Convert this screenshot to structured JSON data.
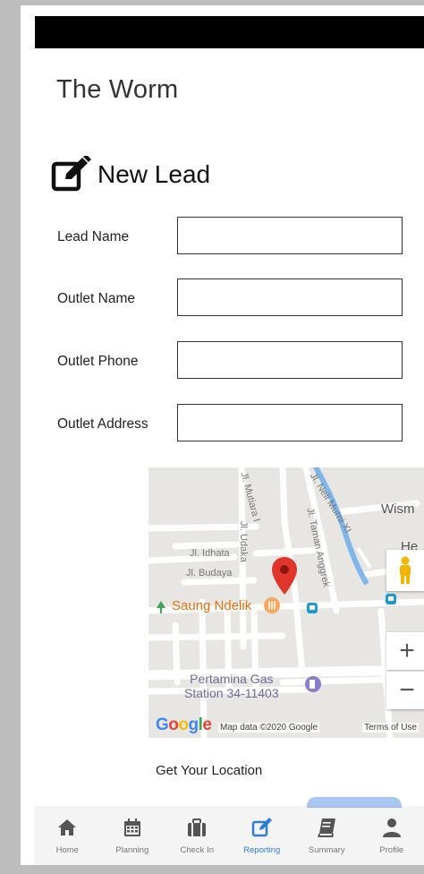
{
  "app": {
    "title": "The Worm"
  },
  "section": {
    "title": "New Lead",
    "icon": "edit-icon"
  },
  "form": {
    "fields": [
      {
        "label": "Lead Name",
        "value": "",
        "placeholder": ""
      },
      {
        "label": "Outlet Name",
        "value": "",
        "placeholder": ""
      },
      {
        "label": "Outlet Phone",
        "value": "",
        "placeholder": ""
      },
      {
        "label": "Outlet Address",
        "value": "",
        "placeholder": ""
      }
    ]
  },
  "map": {
    "labels": {
      "road_udaka": "Jl. Udaka",
      "road_taman_anggrek": "Jl. Taman Anggrek",
      "road_idhata": "Jl. Idhata",
      "road_budaya": "Jl. Budaya",
      "road_neli_murni": "Jl. Neli Murni XI",
      "area_wism": "Wism",
      "area_he": "He",
      "road_top": "Jl. Mutiara I",
      "poi_saung": "Saung Ndelik",
      "poi_pertamina_line1": "Pertamina Gas",
      "poi_pertamina_line2": "Station 34-11403"
    },
    "google_logo": "Google",
    "attribution": "Map data ©2020 Google",
    "terms": "Terms of Use",
    "zoom_in": "+",
    "zoom_out": "−"
  },
  "location": {
    "label": "Get Your Location"
  },
  "colors": {
    "active": "#2f7bd9",
    "inactive": "#555555",
    "marker": "#d93025",
    "poi": "#e8710a"
  },
  "nav": {
    "items": [
      {
        "label": "Home",
        "icon": "home-icon",
        "active": false
      },
      {
        "label": "Planning",
        "icon": "calendar-icon",
        "active": false
      },
      {
        "label": "Check In",
        "icon": "briefcase-icon",
        "active": false
      },
      {
        "label": "Reporting",
        "icon": "edit-icon",
        "active": true
      },
      {
        "label": "Summary",
        "icon": "book-icon",
        "active": false
      },
      {
        "label": "Profile",
        "icon": "user-icon",
        "active": false
      }
    ]
  }
}
